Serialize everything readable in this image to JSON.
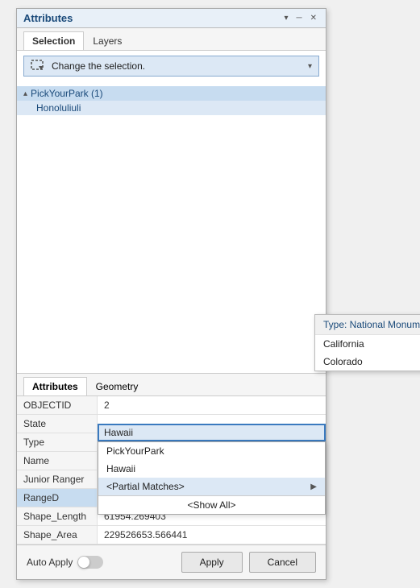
{
  "panel": {
    "title": "Attributes",
    "tabs": [
      {
        "label": "Selection",
        "active": true
      },
      {
        "label": "Layers",
        "active": false
      }
    ],
    "toolbar": {
      "selection_dropdown_label": "Change the selection."
    },
    "tree": {
      "group": {
        "label": "PickYourPark (1)",
        "item": "Honoluliuli"
      }
    }
  },
  "bottom": {
    "tabs": [
      {
        "label": "Attributes",
        "active": true
      },
      {
        "label": "Geometry",
        "active": false
      }
    ],
    "fields": [
      {
        "name": "OBJECTID",
        "value": "2",
        "highlighted": false
      },
      {
        "name": "State",
        "value": "Hawaii",
        "highlighted": false,
        "editable": true
      },
      {
        "name": "Type",
        "value": "",
        "highlighted": false
      },
      {
        "name": "Name",
        "value": "",
        "highlighted": false
      },
      {
        "name": "Junior Ranger",
        "value": "",
        "highlighted": false
      },
      {
        "name": "RangeD",
        "value": "",
        "highlighted": true
      },
      {
        "name": "Shape_Length",
        "value": "61954.269403",
        "highlighted": false
      },
      {
        "name": "Shape_Area",
        "value": "229526653.566441",
        "highlighted": false
      }
    ],
    "state_dropdown": {
      "input_value": "Hawaii",
      "items": [
        {
          "label": "PickYourPark",
          "type": "normal"
        },
        {
          "label": "Hawaii",
          "type": "normal"
        },
        {
          "label": "<Partial Matches>",
          "type": "partial",
          "has_submenu": true
        },
        {
          "label": "<Show All>",
          "type": "show-all"
        }
      ]
    }
  },
  "submenu": {
    "header": "Type: National Monument",
    "items": [
      "California",
      "Colorado"
    ]
  },
  "footer": {
    "auto_apply_label": "Auto Apply",
    "apply_label": "Apply",
    "cancel_label": "Cancel"
  },
  "icons": {
    "selection": "⊹",
    "chevron_down": "▾",
    "chevron_right": "▶",
    "triangle_down": "▴",
    "pin": "⊕"
  }
}
